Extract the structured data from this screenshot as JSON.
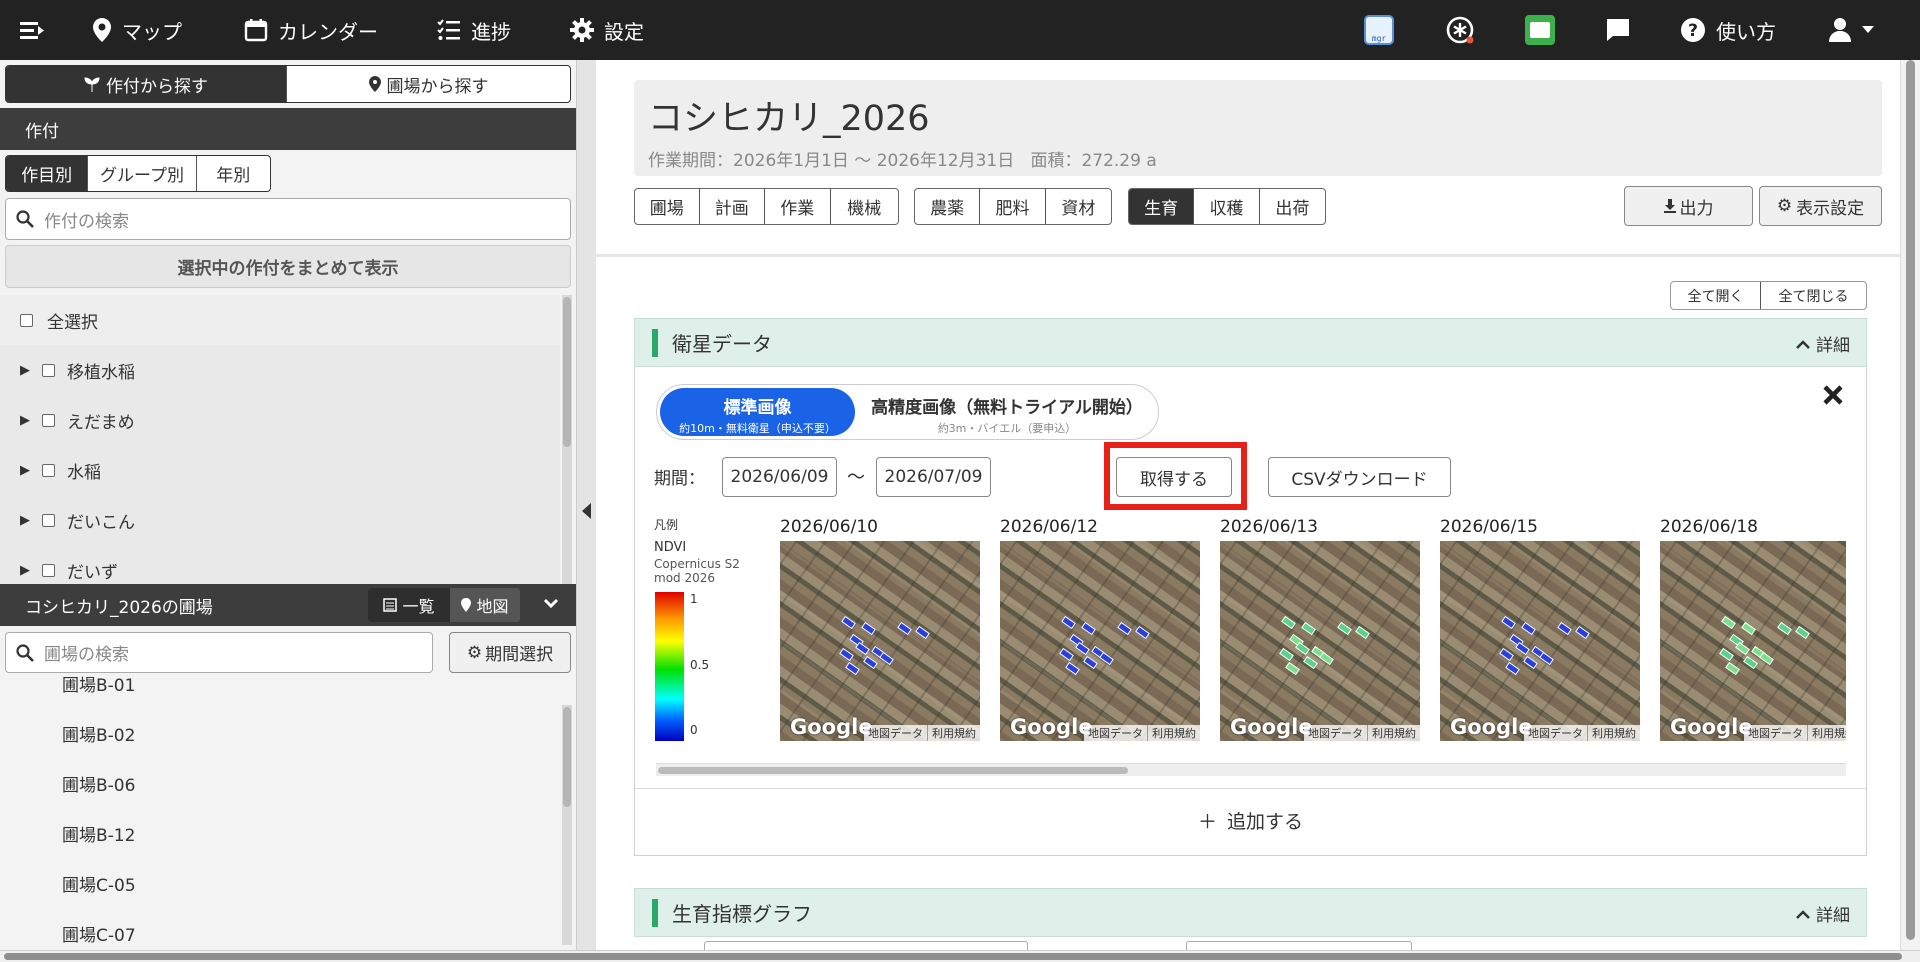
{
  "topbar": {
    "map": "マップ",
    "calendar": "カレンダー",
    "progress": "進捗",
    "settings": "設定",
    "help": "使い方"
  },
  "sidebar": {
    "search_tabs": [
      "作付から探す",
      "圃場から探す"
    ],
    "crop_section_title": "作付",
    "view_tabs": [
      "作目別",
      "グループ別",
      "年別"
    ],
    "crop_search_placeholder": "作付の検索",
    "show_selected_button": "選択中の作付をまとめて表示",
    "select_all": "全選択",
    "crops": [
      "移植水稲",
      "えだまめ",
      "水稲",
      "だいこん",
      "だいず"
    ],
    "fields_title": "コシヒカリ_2026の圃場",
    "list_tab": "一覧",
    "map_tab": "地図",
    "field_search_placeholder": "圃場の検索",
    "period_select_button": "期間選択",
    "fields": [
      "圃場B-01",
      "圃場B-02",
      "圃場B-06",
      "圃場B-12",
      "圃場C-05",
      "圃場C-07"
    ]
  },
  "header": {
    "title": "コシヒカリ_2026",
    "meta": "作業期間：2026年1月1日 〜 2026年12月31日   面積：272.29 a",
    "tabs_group1": [
      "圃場",
      "計画",
      "作業",
      "機械"
    ],
    "tabs_group2": [
      "農薬",
      "肥料",
      "資材"
    ],
    "tabs_group3": [
      "生育",
      "収穫",
      "出荷"
    ],
    "active_tab": "生育",
    "export_button": "出力",
    "display_settings_button": "表示設定"
  },
  "controls": {
    "expand_all": "全て開く",
    "collapse_all": "全て閉じる"
  },
  "satellite": {
    "title": "衛星データ",
    "detail": "詳細",
    "standard_label": "標準画像",
    "standard_sub": "約10m・無料衛星（申込不要）",
    "high_label": "高精度画像（無料トライアル開始）",
    "high_sub": "約3m・バイエル（要申込）",
    "period_label": "期間：",
    "start_date": "2026/06/09",
    "tilde": "〜",
    "end_date": "2026/07/09",
    "fetch_button": "取得する",
    "csv_button": "CSVダウンロード",
    "legend": {
      "title": "凡例",
      "index": "NDVI",
      "source": "Copernicus S2 mod 2026",
      "max": "1",
      "mid": "0.5",
      "min": "0"
    },
    "images": [
      {
        "date": "2026/06/10",
        "level": "low"
      },
      {
        "date": "2026/06/12",
        "level": "low"
      },
      {
        "date": "2026/06/13",
        "level": "mid"
      },
      {
        "date": "2026/06/15",
        "level": "low"
      },
      {
        "date": "2026/06/18",
        "level": "mid"
      }
    ],
    "map_footer_data": "地図データ",
    "map_footer_terms": "利用規約",
    "map_logo": "Google",
    "add_button": "追加する"
  },
  "growth_graph": {
    "title": "生育指標グラフ",
    "detail": "詳細"
  },
  "colors": {
    "topbar": "#222222",
    "active_pill": "#1a63e6",
    "highlight": "#e8201a",
    "section_accent": "#2aa86b"
  }
}
